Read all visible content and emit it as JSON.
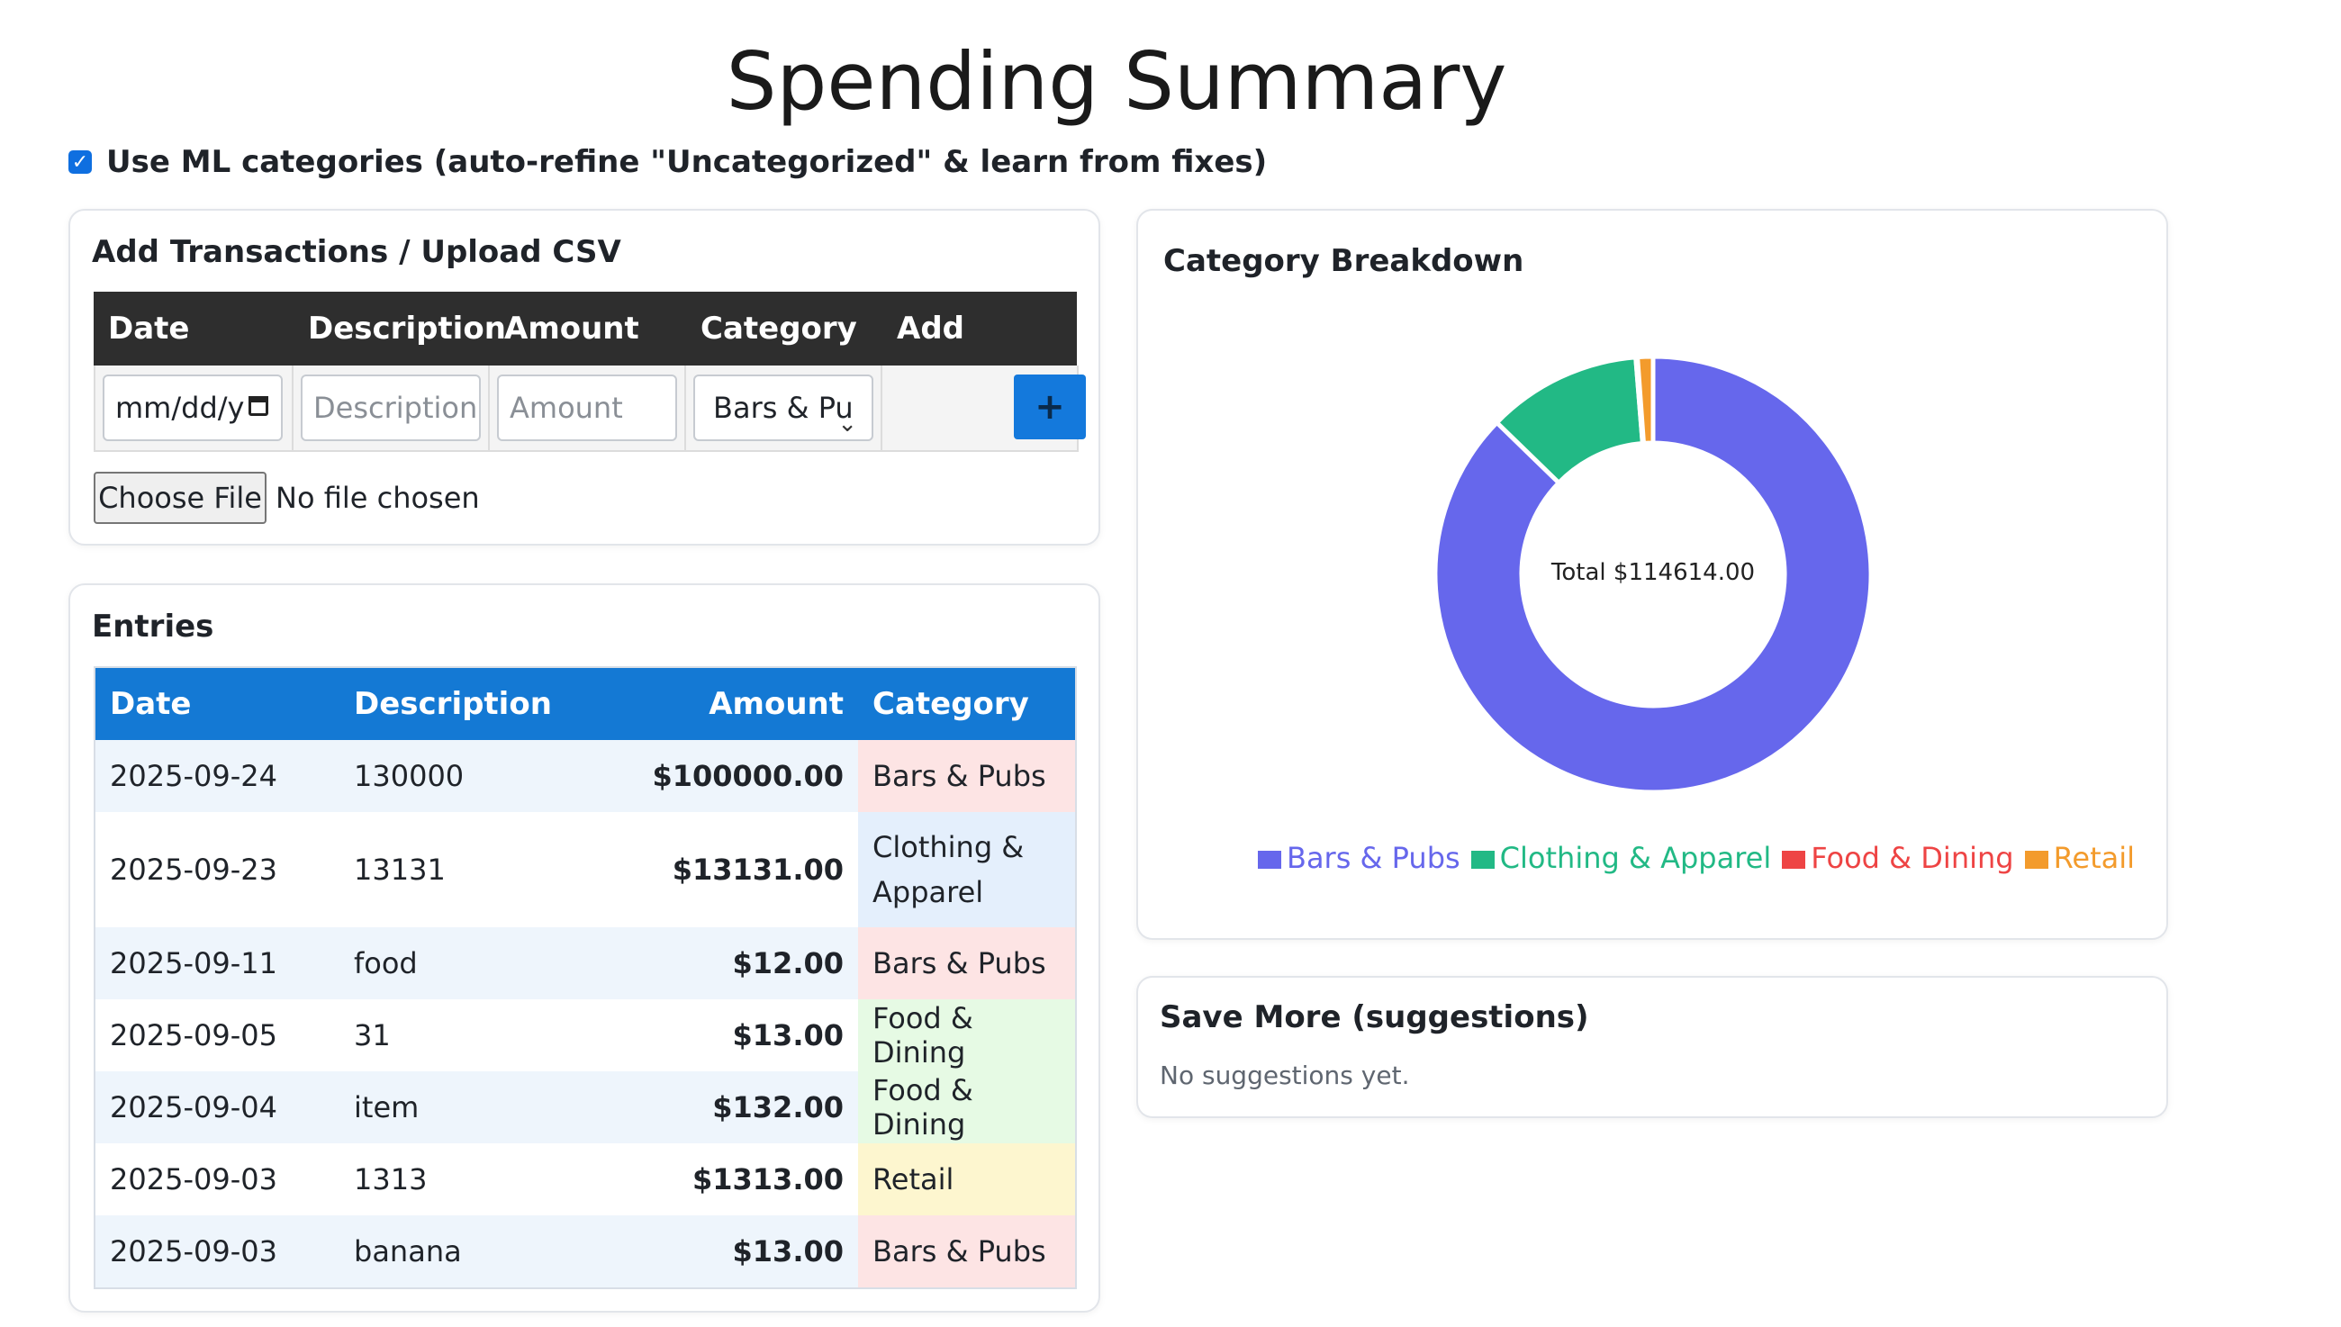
{
  "page": {
    "title": "Spending Summary"
  },
  "ml_toggle": {
    "checked": true,
    "label": "Use ML categories (auto-refine \"Uncategorized\" & learn from fixes)"
  },
  "add_card": {
    "title": "Add Transactions / Upload CSV",
    "headers": [
      "Date",
      "Description",
      "Amount",
      "Category",
      "Add"
    ],
    "date_value": "mm/dd/y",
    "description_placeholder": "Description",
    "amount_placeholder": "Amount",
    "category_value": "Bars & Pu",
    "add_button": "+",
    "choose_file": "Choose File",
    "no_file": "No file chosen"
  },
  "entries": {
    "title": "Entries",
    "headers": [
      "Date",
      "Description",
      "Amount",
      "Category"
    ],
    "rows": [
      {
        "date": "2025-09-24",
        "description": "130000",
        "amount": "$100000.00",
        "category": "Bars & Pubs"
      },
      {
        "date": "2025-09-23",
        "description": "13131",
        "amount": "$13131.00",
        "category": "Clothing & Apparel"
      },
      {
        "date": "2025-09-11",
        "description": "food",
        "amount": "$12.00",
        "category": "Bars & Pubs"
      },
      {
        "date": "2025-09-05",
        "description": "31",
        "amount": "$13.00",
        "category": "Food & Dining"
      },
      {
        "date": "2025-09-04",
        "description": "item",
        "amount": "$132.00",
        "category": "Food & Dining"
      },
      {
        "date": "2025-09-03",
        "description": "1313",
        "amount": "$1313.00",
        "category": "Retail"
      },
      {
        "date": "2025-09-03",
        "description": "banana",
        "amount": "$13.00",
        "category": "Bars & Pubs"
      }
    ],
    "category_colors": {
      "Bars & Pubs": "#fde4e4",
      "Clothing & Apparel": "#e4effc",
      "Food & Dining": "#e6fae4",
      "Retail": "#fdf6cf"
    }
  },
  "breakdown": {
    "title": "Category Breakdown",
    "center_label": "Total $114614.00"
  },
  "chart_data": {
    "type": "pie",
    "categories": [
      "Bars & Pubs",
      "Clothing & Apparel",
      "Food & Dining",
      "Retail"
    ],
    "values": [
      100025,
      13131,
      145,
      1313
    ],
    "colors": [
      "#6667ec",
      "#22b985",
      "#ee4444",
      "#f39b2c"
    ]
  },
  "suggestions": {
    "title": "Save More (suggestions)",
    "empty_text": "No suggestions yet."
  }
}
